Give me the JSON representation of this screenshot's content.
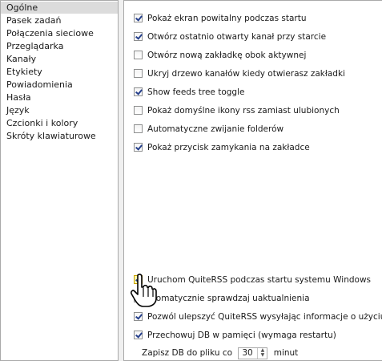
{
  "sidebar": {
    "items": [
      {
        "label": "Ogólne"
      },
      {
        "label": "Pasek zadań"
      },
      {
        "label": "Połączenia sieciowe"
      },
      {
        "label": "Przeglądarka"
      },
      {
        "label": "Kanały"
      },
      {
        "label": "Etykiety"
      },
      {
        "label": "Powiadomienia"
      },
      {
        "label": "Hasła"
      },
      {
        "label": "Język"
      },
      {
        "label": "Czcionki i kolory"
      },
      {
        "label": "Skróty klawiaturowe"
      }
    ]
  },
  "options": {
    "top": [
      {
        "label": "Pokaż ekran powitalny podczas startu",
        "checked": true
      },
      {
        "label": "Otwórz ostatnio otwarty kanał przy starcie",
        "checked": true
      },
      {
        "label": "Otwórz nową zakładkę obok aktywnej",
        "checked": false
      },
      {
        "label": "Ukryj drzewo kanałów kiedy otwierasz zakładki",
        "checked": false
      },
      {
        "label": "Show feeds tree toggle",
        "checked": true
      },
      {
        "label": "Pokaż domyślne ikony rss zamiast ulubionych",
        "checked": false
      },
      {
        "label": "Automatyczne zwijanie folderów",
        "checked": false
      },
      {
        "label": "Pokaż przycisk zamykania na zakładce",
        "checked": true
      }
    ],
    "bottom": [
      {
        "label": "Uruchom QuiteRSS podczas startu systemu Windows",
        "checked": true
      },
      {
        "label": "utomatycznie sprawdzaj uaktualnienia",
        "checked": false
      },
      {
        "label": "Pozwól ulepszyć QuiteRSS wysyłając informacje o użyciu",
        "checked": true
      },
      {
        "label": "Przechowuj DB w pamięci (wymaga restartu)",
        "checked": true
      }
    ],
    "save_db": {
      "label_before": "Zapisz DB do pliku co",
      "value": "30",
      "label_after": "minut"
    }
  },
  "cursor_icon": "hand-pointer-icon"
}
